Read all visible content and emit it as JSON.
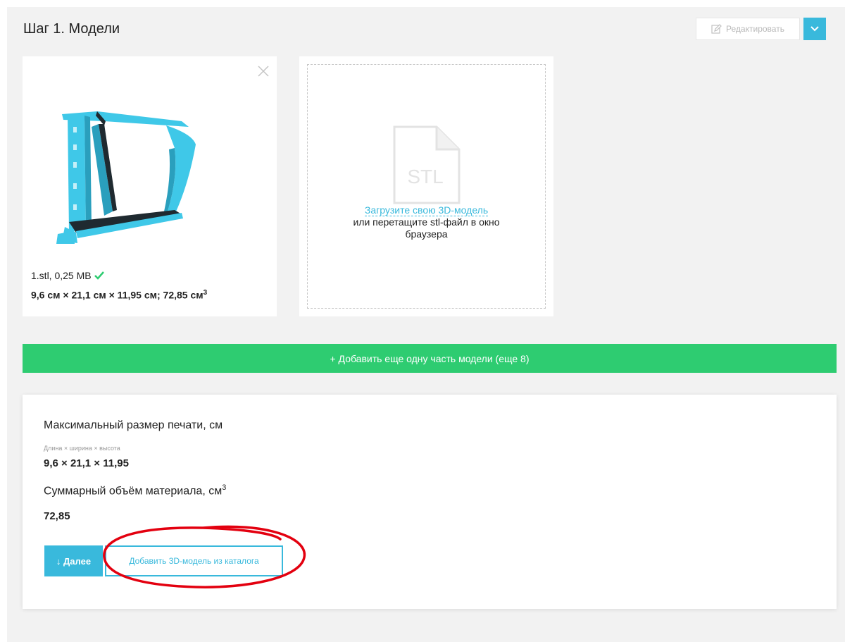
{
  "step": {
    "title": "Шаг 1. Модели"
  },
  "toolbar": {
    "edit_label": "Редактировать",
    "dropdown_icon": "chevron-down-icon"
  },
  "model": {
    "file_info": "1.stl, 0,25 MB",
    "dims_text": "9,6 см × 21,1 см × 11,95 см; 72,85 см",
    "dims_sup": "3"
  },
  "upload": {
    "icon_label": "STL",
    "link_text": "Загрузите свою 3D-модель",
    "hint_line1": "или перетащите stl-файл в окно",
    "hint_line2": "браузера"
  },
  "add_part": {
    "label": "+ Добавить еще одну часть модели (еще 8)"
  },
  "summary": {
    "max_size_title": "Максимальный размер печати, см",
    "dims_caption": "Длина × ширина × высота",
    "dims_value": "9,6 × 21,1 × 11,95",
    "volume_title": "Суммарный объём материала, см",
    "volume_sup": "3",
    "volume_value": "72,85"
  },
  "actions": {
    "next_label": "↓ Далее",
    "catalog_label": "Добавить 3D-модель из каталога"
  },
  "colors": {
    "accent": "#39b9dc",
    "success": "#2ecc71",
    "model": "#3fc8e8",
    "highlight": "#e3000f"
  }
}
